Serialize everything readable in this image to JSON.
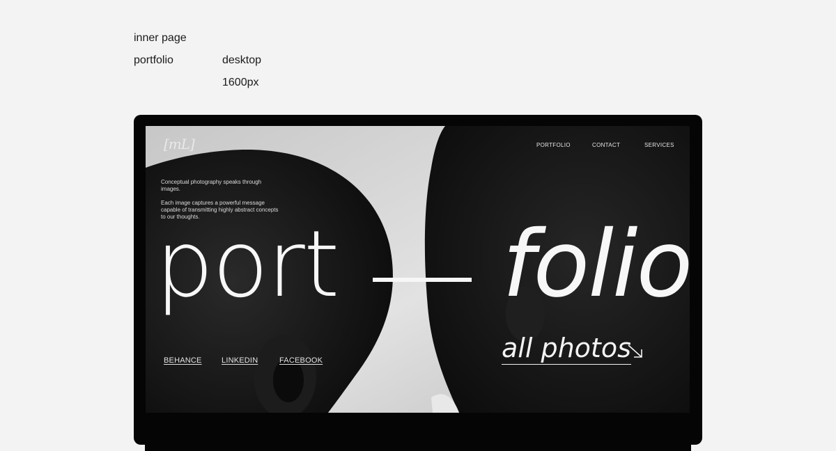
{
  "meta": {
    "label_1": "inner page",
    "label_2": "portfolio",
    "label_3": "desktop",
    "label_4": "1600px"
  },
  "site": {
    "logo": "[mL]",
    "nav": {
      "portfolio": "PORTFOLIO",
      "contact": "CONTACT",
      "services": "SERVICES"
    },
    "intro": {
      "line_1": "Conceptual photography speaks through images.",
      "line_2": "Each image captures a powerful message capable of transmitting highly abstract concepts to our thoughts."
    },
    "hero": {
      "left": "port",
      "right": "folio"
    },
    "social": {
      "behance": "BEHANCE",
      "linkedin": "LINKEDIN",
      "facebook": "FACEBOOK"
    },
    "all_photos": "all photos",
    "icons": {
      "arrow": "arrow-down-right-icon"
    }
  }
}
